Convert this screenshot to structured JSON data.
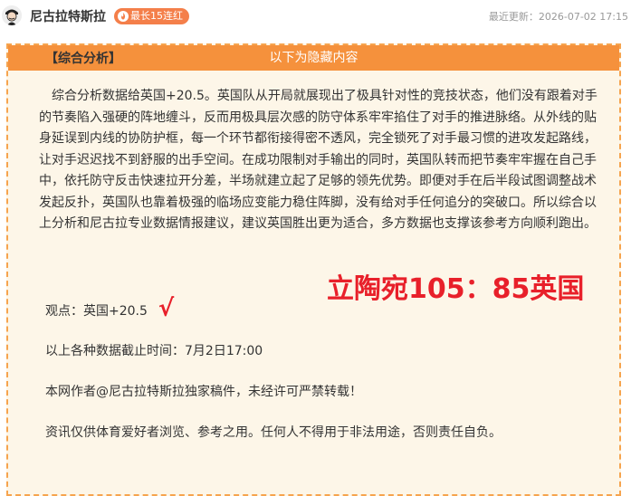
{
  "header": {
    "author_name": "尼古拉特斯拉",
    "streak_badge": "最长15连红",
    "last_update": "最近更新：2026-07-02 17:15"
  },
  "content": {
    "hidden_notice": "以下为隐藏内容",
    "section_title": "【综合分析】",
    "analysis_paragraph": "综合分析数据给英国+20.5。英国队从开局就展现出了极具针对性的竞技状态，他们没有跟着对手的节奏陷入强硬的阵地缠斗，反而用极具层次感的防守体系牢牢掐住了对手的推进脉络。从外线的贴身延误到内线的协防护框，每一个环节都衔接得密不透风，完全锁死了对手最习惯的进攻发起路线，让对手迟迟找不到舒服的出手空间。在成功限制对手输出的同时，英国队转而把节奏牢牢握在自己手中，依托防守反击快速拉开分差，半场就建立起了足够的领先优势。即便对手在后半段试图调整战术发起反扑，英国队也靠着极强的临场应变能力稳住阵脚，没有给对手任何追分的突破口。所以综合以上分析和尼古拉专业数据情报建议，建议英国胜出更为适合，多方数据也支撑该参考方向顺利跑出。",
    "viewpoint": "观点：英国+20.5",
    "check_mark": "√",
    "score_result": "立陶宛105：85英国",
    "cutoff_time": "以上各种数据截止时间：7月2日17:00",
    "copyright": "本网作者@尼古拉特斯拉独家稿件，未经许可严禁转载！",
    "disclaimer": "资讯仅供体育爱好者浏览、参考之用。任何人不得用于非法用途，否则责任自负。"
  },
  "colors": {
    "accent_orange": "#f5913c",
    "panel_background": "#fdf6e8",
    "result_red": "#e8202a"
  },
  "icons": {
    "avatar": "avatar-portrait",
    "badge": "fire-icon"
  }
}
